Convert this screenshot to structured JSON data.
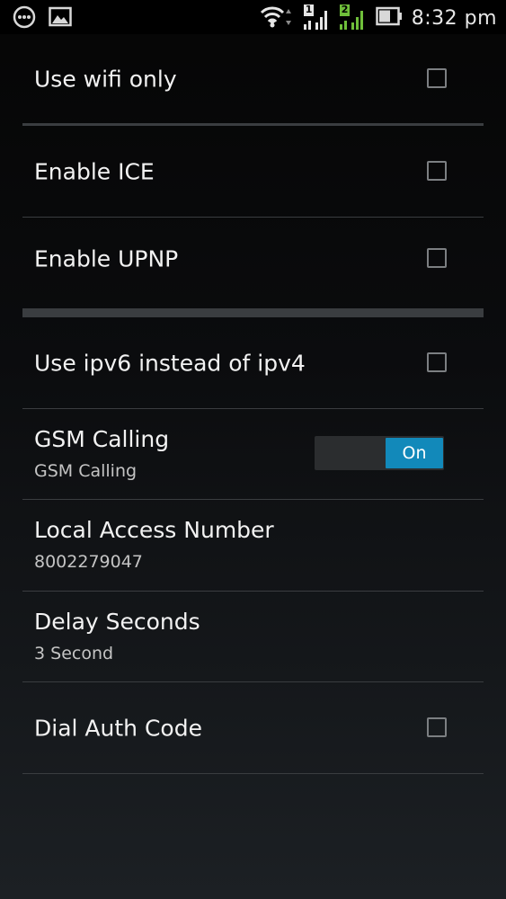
{
  "status_bar": {
    "time": "8:32 pm",
    "sim1_label": "1",
    "sim2_label": "2",
    "icons": [
      "chat-icon",
      "image-icon",
      "wifi-icon",
      "sim1-signal-icon",
      "sim2-signal-icon",
      "battery-icon"
    ],
    "sim2_color": "#6fbf3a"
  },
  "settings": {
    "use_wifi_only": {
      "title": "Use wifi only",
      "checked": false
    },
    "enable_ice": {
      "title": "Enable ICE",
      "checked": false
    },
    "enable_upnp": {
      "title": "Enable UPNP",
      "checked": false
    },
    "use_ipv6": {
      "title": "Use ipv6 instead of ipv4",
      "checked": false
    },
    "gsm_calling": {
      "title": "GSM Calling",
      "summary": "GSM Calling",
      "toggle_label": "On",
      "enabled": true
    },
    "local_access_number": {
      "title": "Local Access Number",
      "summary": "8002279047"
    },
    "delay_seconds": {
      "title": "Delay Seconds",
      "summary": "3 Second"
    },
    "dial_auth_code": {
      "title": "Dial Auth Code",
      "checked": false
    }
  },
  "colors": {
    "accent": "#1289ba",
    "divider": "#3a3d40",
    "checkbox_border": "#7c7f82"
  }
}
